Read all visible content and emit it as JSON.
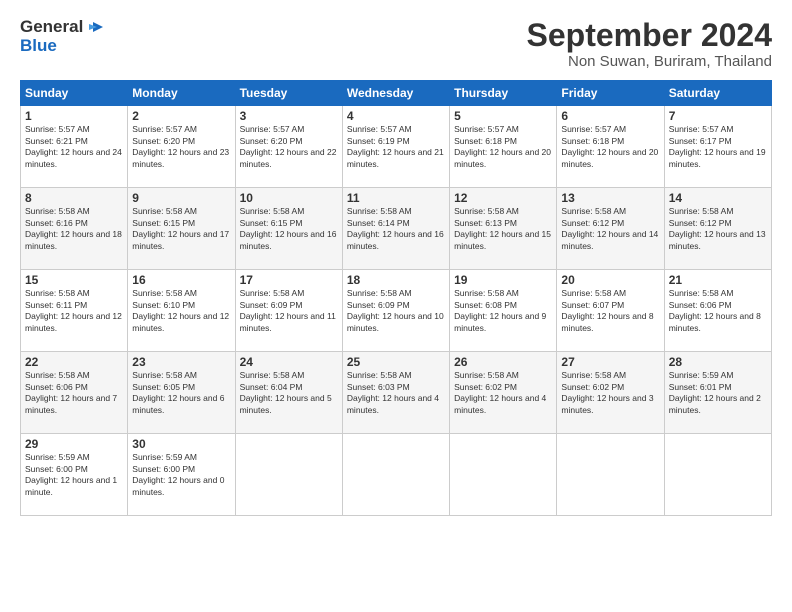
{
  "logo": {
    "line1": "General",
    "line2": "Blue"
  },
  "title": "September 2024",
  "subtitle": "Non Suwan, Buriram, Thailand",
  "days_header": [
    "Sunday",
    "Monday",
    "Tuesday",
    "Wednesday",
    "Thursday",
    "Friday",
    "Saturday"
  ],
  "weeks": [
    [
      {
        "num": "1",
        "sunrise": "5:57 AM",
        "sunset": "6:21 PM",
        "daylight": "12 hours and 24 minutes."
      },
      {
        "num": "2",
        "sunrise": "5:57 AM",
        "sunset": "6:20 PM",
        "daylight": "12 hours and 23 minutes."
      },
      {
        "num": "3",
        "sunrise": "5:57 AM",
        "sunset": "6:20 PM",
        "daylight": "12 hours and 22 minutes."
      },
      {
        "num": "4",
        "sunrise": "5:57 AM",
        "sunset": "6:19 PM",
        "daylight": "12 hours and 21 minutes."
      },
      {
        "num": "5",
        "sunrise": "5:57 AM",
        "sunset": "6:18 PM",
        "daylight": "12 hours and 20 minutes."
      },
      {
        "num": "6",
        "sunrise": "5:57 AM",
        "sunset": "6:18 PM",
        "daylight": "12 hours and 20 minutes."
      },
      {
        "num": "7",
        "sunrise": "5:57 AM",
        "sunset": "6:17 PM",
        "daylight": "12 hours and 19 minutes."
      }
    ],
    [
      {
        "num": "8",
        "sunrise": "5:58 AM",
        "sunset": "6:16 PM",
        "daylight": "12 hours and 18 minutes."
      },
      {
        "num": "9",
        "sunrise": "5:58 AM",
        "sunset": "6:15 PM",
        "daylight": "12 hours and 17 minutes."
      },
      {
        "num": "10",
        "sunrise": "5:58 AM",
        "sunset": "6:15 PM",
        "daylight": "12 hours and 16 minutes."
      },
      {
        "num": "11",
        "sunrise": "5:58 AM",
        "sunset": "6:14 PM",
        "daylight": "12 hours and 16 minutes."
      },
      {
        "num": "12",
        "sunrise": "5:58 AM",
        "sunset": "6:13 PM",
        "daylight": "12 hours and 15 minutes."
      },
      {
        "num": "13",
        "sunrise": "5:58 AM",
        "sunset": "6:12 PM",
        "daylight": "12 hours and 14 minutes."
      },
      {
        "num": "14",
        "sunrise": "5:58 AM",
        "sunset": "6:12 PM",
        "daylight": "12 hours and 13 minutes."
      }
    ],
    [
      {
        "num": "15",
        "sunrise": "5:58 AM",
        "sunset": "6:11 PM",
        "daylight": "12 hours and 12 minutes."
      },
      {
        "num": "16",
        "sunrise": "5:58 AM",
        "sunset": "6:10 PM",
        "daylight": "12 hours and 12 minutes."
      },
      {
        "num": "17",
        "sunrise": "5:58 AM",
        "sunset": "6:09 PM",
        "daylight": "12 hours and 11 minutes."
      },
      {
        "num": "18",
        "sunrise": "5:58 AM",
        "sunset": "6:09 PM",
        "daylight": "12 hours and 10 minutes."
      },
      {
        "num": "19",
        "sunrise": "5:58 AM",
        "sunset": "6:08 PM",
        "daylight": "12 hours and 9 minutes."
      },
      {
        "num": "20",
        "sunrise": "5:58 AM",
        "sunset": "6:07 PM",
        "daylight": "12 hours and 8 minutes."
      },
      {
        "num": "21",
        "sunrise": "5:58 AM",
        "sunset": "6:06 PM",
        "daylight": "12 hours and 8 minutes."
      }
    ],
    [
      {
        "num": "22",
        "sunrise": "5:58 AM",
        "sunset": "6:06 PM",
        "daylight": "12 hours and 7 minutes."
      },
      {
        "num": "23",
        "sunrise": "5:58 AM",
        "sunset": "6:05 PM",
        "daylight": "12 hours and 6 minutes."
      },
      {
        "num": "24",
        "sunrise": "5:58 AM",
        "sunset": "6:04 PM",
        "daylight": "12 hours and 5 minutes."
      },
      {
        "num": "25",
        "sunrise": "5:58 AM",
        "sunset": "6:03 PM",
        "daylight": "12 hours and 4 minutes."
      },
      {
        "num": "26",
        "sunrise": "5:58 AM",
        "sunset": "6:02 PM",
        "daylight": "12 hours and 4 minutes."
      },
      {
        "num": "27",
        "sunrise": "5:58 AM",
        "sunset": "6:02 PM",
        "daylight": "12 hours and 3 minutes."
      },
      {
        "num": "28",
        "sunrise": "5:59 AM",
        "sunset": "6:01 PM",
        "daylight": "12 hours and 2 minutes."
      }
    ],
    [
      {
        "num": "29",
        "sunrise": "5:59 AM",
        "sunset": "6:00 PM",
        "daylight": "12 hours and 1 minute."
      },
      {
        "num": "30",
        "sunrise": "5:59 AM",
        "sunset": "6:00 PM",
        "daylight": "12 hours and 0 minutes."
      },
      null,
      null,
      null,
      null,
      null
    ]
  ]
}
